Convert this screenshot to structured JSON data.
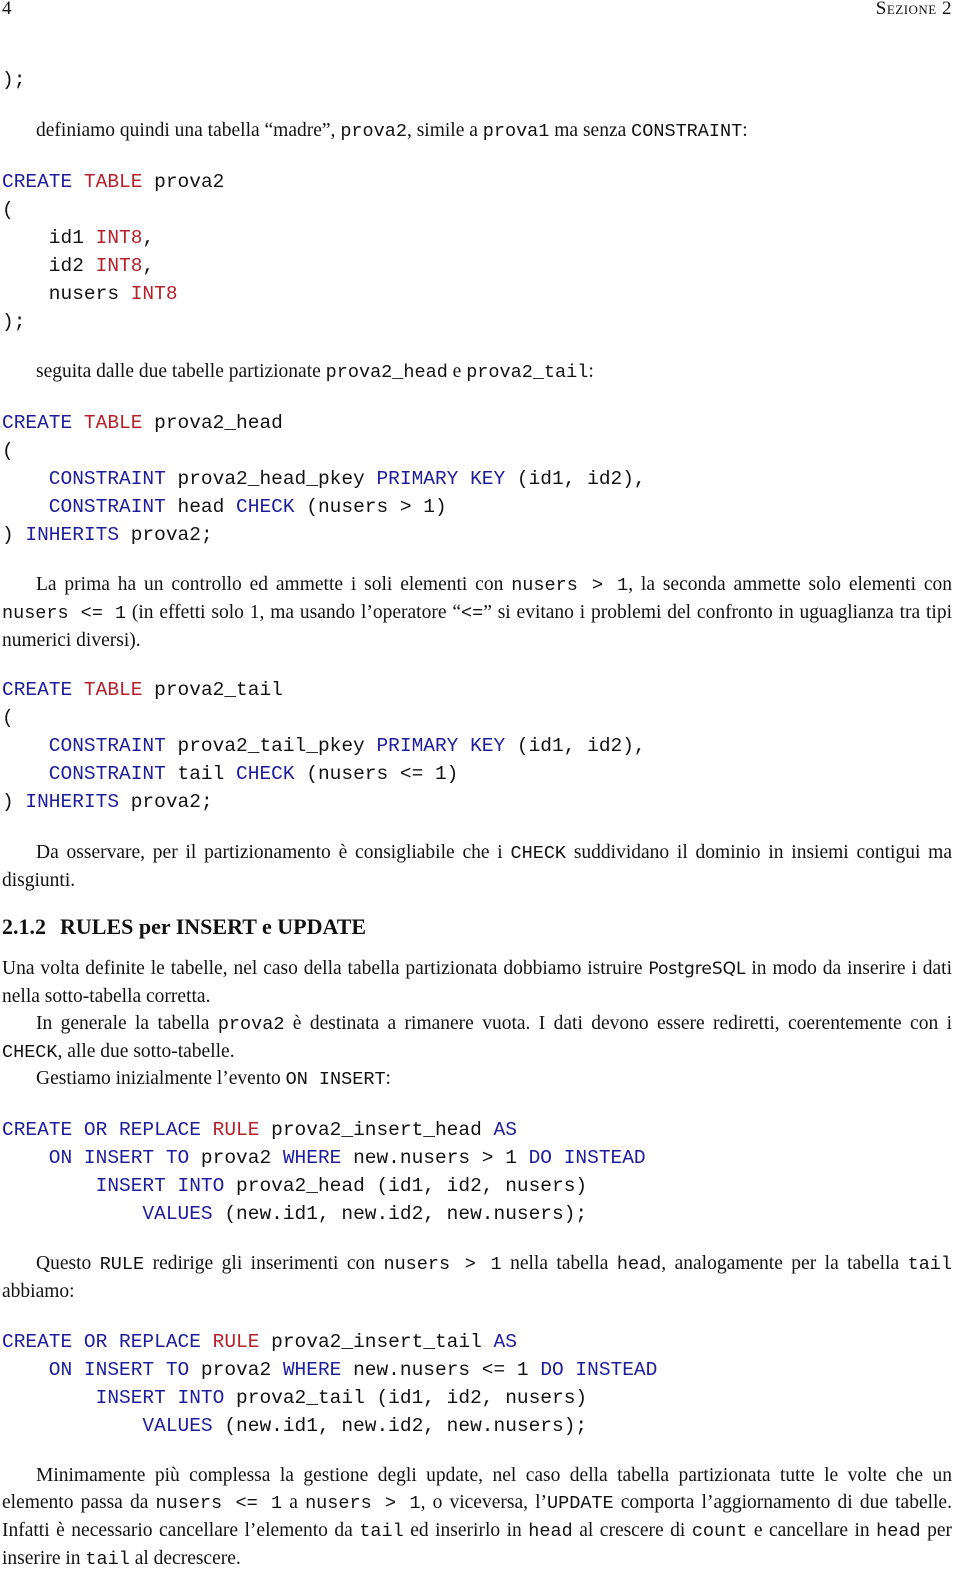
{
  "header": {
    "page_number": "4",
    "running_head": "Sezione 2"
  },
  "top_code_tail": ");",
  "intro": {
    "t1": "definiamo quindi una tabella “madre”, ",
    "c1": "prova2",
    "t2": ", simile a ",
    "c2": "prova1",
    "t3": " ma senza ",
    "c3": "CONSTRAINT",
    "t4": ":"
  },
  "code_prova2": {
    "kw_create": "CREATE",
    "kw_table": "TABLE",
    "name": " prova2",
    "open": "(",
    "cols": [
      {
        "name": "    id1 ",
        "type": "INT8",
        "tail": ","
      },
      {
        "name": "    id2 ",
        "type": "INT8",
        "tail": ","
      },
      {
        "name": "    nusers ",
        "type": "INT8",
        "tail": ""
      }
    ],
    "close": ");"
  },
  "para_partitions": {
    "t1": "seguita dalle due tabelle partizionate ",
    "c1": "prova2_head",
    "t2": " e ",
    "c2": "prova2_tail",
    "t3": ":"
  },
  "code_head": {
    "kw_create": "CREATE",
    "kw_table": "TABLE",
    "name": " prova2_head",
    "open": "(",
    "l1_kw": "    CONSTRAINT",
    "l1_name": " prova2_head_pkey ",
    "l1_kw2": "PRIMARY KEY",
    "l1_rest": " (id1, id2),",
    "l2_kw": "    CONSTRAINT",
    "l2_name": " head ",
    "l2_kw2": "CHECK",
    "l2_rest": " (nusers > 1)",
    "close_paren": ") ",
    "kw_inherits": "INHERITS",
    "inherits_rest": " prova2;"
  },
  "para_first": {
    "t1": "La prima ha un controllo ed ammette i soli elementi con ",
    "c1": "nusers > 1",
    "t2": ", la seconda ammette solo elementi con ",
    "c2": "nusers <= 1",
    "t3": " (in effetti solo 1, ma usando l’operatore “",
    "c3": "<=",
    "t4": "” si evitano i problemi del confronto in uguaglianza tra tipi numerici diversi)."
  },
  "code_tail": {
    "kw_create": "CREATE",
    "kw_table": "TABLE",
    "name": " prova2_tail",
    "open": "(",
    "l1_kw": "    CONSTRAINT",
    "l1_name": " prova2_tail_pkey ",
    "l1_kw2": "PRIMARY KEY",
    "l1_rest": " (id1, id2),",
    "l2_kw": "    CONSTRAINT",
    "l2_name": " tail ",
    "l2_kw2": "CHECK",
    "l2_rest": " (nusers <= 1)",
    "close_paren": ") ",
    "kw_inherits": "INHERITS",
    "inherits_rest": " prova2;"
  },
  "para_observe": {
    "t1": "Da osservare, per il partizionamento è consigliabile che i ",
    "c1": "CHECK",
    "t2": " suddividano il dominio in insiemi contigui ma disgiunti."
  },
  "section": {
    "number": "2.1.2",
    "title": "RULES per INSERT e UPDATE"
  },
  "para_rules1": {
    "t1": "Una volta definite le tabelle, nel caso della tabella partizionata dobbiamo istruire ",
    "sf1": "PostgreSQL",
    "t2": " in modo da inserire i dati nella sotto-tabella corretta."
  },
  "para_rules2": {
    "t1": "In generale la tabella ",
    "c1": "prova2",
    "t2": " è destinata a rimanere vuota. I dati devono essere rediretti, coerentemente con i ",
    "c2": "CHECK",
    "t3": ", alle due sotto-tabelle."
  },
  "para_rules3": {
    "t1": "Gestiamo inizialmente l’evento ",
    "c1": "ON INSERT",
    "t2": ":"
  },
  "rule_head": {
    "l1_kw": "CREATE OR REPLACE",
    "l1_kw_red": " RULE",
    "l1_name": " prova2_insert_head ",
    "l1_as": "AS",
    "l2_kw": "    ON INSERT TO",
    "l2_name": " prova2 ",
    "l2_where": "WHERE",
    "l2_cond": " new.nusers > 1 ",
    "l2_do": "DO INSTEAD",
    "l3_kw": "        INSERT INTO",
    "l3_rest": " prova2_head (id1, id2, nusers)",
    "l4_kw": "            VALUES",
    "l4_rest": " (new.id1, new.id2, new.nusers);"
  },
  "para_rule_expl": {
    "t1": "Questo ",
    "c1": "RULE",
    "t2": " redirige gli inserimenti con ",
    "c2": "nusers > 1",
    "t3": " nella tabella ",
    "c3": "head",
    "t4": ", analogamente per la tabella ",
    "c4": "tail",
    "t5": " abbiamo:"
  },
  "rule_tail": {
    "l1_kw": "CREATE OR REPLACE",
    "l1_kw_red": " RULE",
    "l1_name": " prova2_insert_tail ",
    "l1_as": "AS",
    "l2_kw": "    ON INSERT TO",
    "l2_name": " prova2 ",
    "l2_where": "WHERE",
    "l2_cond": " new.nusers <= 1 ",
    "l2_do": "DO INSTEAD",
    "l3_kw": "        INSERT INTO",
    "l3_rest": " prova2_tail (id1, id2, nusers)",
    "l4_kw": "            VALUES",
    "l4_rest": " (new.id1, new.id2, new.nusers);"
  },
  "para_update": {
    "t1": "Minimamente più complessa la gestione degli update, nel caso della tabella partizionata tutte le volte che un elemento passa da ",
    "c1": "nusers <= 1",
    "t2": " a ",
    "c2": "nusers > 1",
    "t3": ", o viceversa, l’",
    "c3": "UPDATE",
    "t4": " comporta l’aggiornamento di due tabelle. Infatti è necessario cancellare l’elemento da ",
    "c4": "tail",
    "t5": " ed inserirlo in ",
    "c5": "head",
    "t6": " al crescere di ",
    "c6": "count",
    "t7": " e cancellare in ",
    "c7": "head",
    "t8": " per inserire in ",
    "c8": "tail",
    "t9": " al decrescere."
  }
}
